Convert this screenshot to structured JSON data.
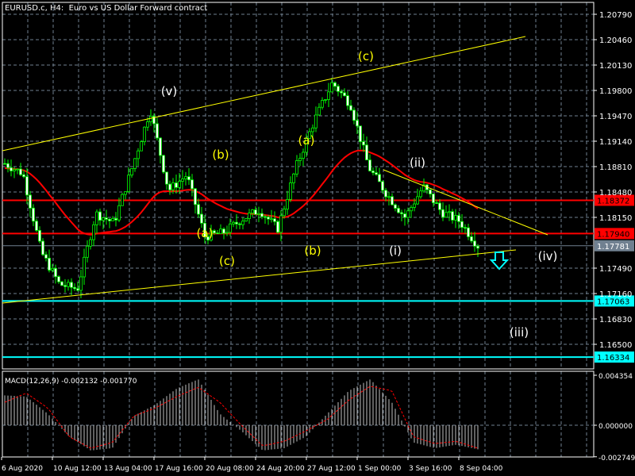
{
  "header": {
    "title": "EURUSD.c, H4:  Euro vs US Dollar Forward contract"
  },
  "price_axis": {
    "ticks": [
      "1.20790",
      "1.20460",
      "1.20130",
      "1.19800",
      "1.19470",
      "1.19140",
      "1.18810",
      "1.18480",
      "1.18150",
      "1.17490",
      "1.17160",
      "1.16830",
      "1.16500"
    ],
    "tick_values": [
      1.2079,
      1.2046,
      1.2013,
      1.198,
      1.1947,
      1.1914,
      1.1881,
      1.1848,
      1.1815,
      1.1749,
      1.1716,
      1.1683,
      1.165
    ]
  },
  "levels": [
    {
      "label": "1.18372",
      "value": 1.18372,
      "color": "#ff0000",
      "text_color": "#000000"
    },
    {
      "label": "1.17940",
      "value": 1.1794,
      "color": "#ff0000",
      "text_color": "#000000"
    },
    {
      "label": "1.17781",
      "value": 1.17781,
      "color": "#708090",
      "text_color": "#ffffff"
    },
    {
      "label": "1.17063",
      "value": 1.17063,
      "color": "#00ffff",
      "text_color": "#000000"
    },
    {
      "label": "1.16334",
      "value": 1.16334,
      "color": "#00ffff",
      "text_color": "#000000"
    }
  ],
  "wave_labels": [
    {
      "text": "(v)",
      "color": "#ffffff"
    },
    {
      "text": "(b)",
      "color": "#ffff00"
    },
    {
      "text": "(a)",
      "color": "#ffff00"
    },
    {
      "text": "(c)",
      "color": "#ffff00"
    },
    {
      "text": "(a)",
      "color": "#ffff00"
    },
    {
      "text": "(b)",
      "color": "#ffff00"
    },
    {
      "text": "(c)",
      "color": "#ffff00"
    },
    {
      "text": "(ii)",
      "color": "#ffffff"
    },
    {
      "text": "(i)",
      "color": "#ffffff"
    },
    {
      "text": "(iv)",
      "color": "#ffffff"
    },
    {
      "text": "(iii)",
      "color": "#ffffff"
    }
  ],
  "time_axis": [
    "6 Aug 2020",
    "10 Aug 12:00",
    "13 Aug 04:00",
    "17 Aug 16:00",
    "20 Aug 08:00",
    "24 Aug 20:00",
    "27 Aug 12:00",
    "1 Sep 00:00",
    "3 Sep 16:00",
    "8 Sep 04:00"
  ],
  "macd": {
    "label": "MACD(12,26,9) -0.002132 -0.001770",
    "ticks": [
      "0.004354",
      "0.000000",
      "-0.002749"
    ],
    "tick_values": [
      0.004354,
      0,
      -0.002749
    ]
  },
  "chart_data": {
    "type": "candlestick",
    "symbol": "EURUSD.c",
    "timeframe": "H4",
    "price_path": [
      1.1885,
      1.1872,
      1.177,
      1.1728,
      1.1722,
      1.182,
      1.1808,
      1.188,
      1.1955,
      1.185,
      1.187,
      1.179,
      1.1795,
      1.1812,
      1.1825,
      1.18,
      1.188,
      1.194,
      1.199,
      1.1962,
      1.188,
      1.1845,
      1.1815,
      1.1855,
      1.1822,
      1.181,
      1.1778
    ],
    "macd_hist_path": [
      0.0026,
      0.0025,
      0.001,
      -0.001,
      -0.0022,
      -0.002,
      0.0008,
      0.0018,
      0.0032,
      0.004,
      0.001,
      -0.0005,
      -0.0022,
      -0.002,
      -0.001,
      0.001,
      0.003,
      0.004,
      0.002,
      -0.0015,
      -0.002,
      -0.0017,
      -0.0021
    ],
    "macd_signal_path": [
      0.002,
      0.0028,
      0.0015,
      -0.001,
      -0.002,
      -0.0015,
      0.0008,
      0.0015,
      0.0025,
      0.0033,
      0.002,
      0.0,
      -0.0018,
      -0.0014,
      -0.0005,
      0.0005,
      0.0022,
      0.0034,
      0.003,
      -0.001,
      -0.0016,
      -0.0014,
      -0.002
    ]
  },
  "colors": {
    "bull_wick": "#00ff00",
    "bear_body": "#ffffff",
    "ma": "#ff0000",
    "trend": "#ffff00",
    "grid": "#708090"
  }
}
